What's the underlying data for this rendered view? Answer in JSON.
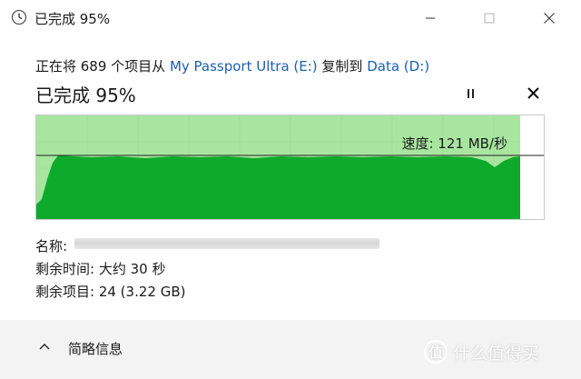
{
  "window": {
    "title": "已完成 95%",
    "icon": "clock-icon"
  },
  "transfer": {
    "desc_prefix": "正在将 689 个项目从",
    "source": "My Passport Ultra (E:)",
    "desc_middle": "复制到",
    "destination": "Data (D:)",
    "status": "已完成 95%",
    "progress_fraction": 0.95,
    "speed": "速度: 121 MB/秒"
  },
  "details": {
    "name_label": "名称:",
    "time_remaining": "剩余时间: 大约 30 秒",
    "items_remaining": "剩余项目: 24 (3.22 GB)"
  },
  "footer": {
    "less_details": "简略信息",
    "watermark": "什么值得买"
  },
  "colors": {
    "progress_light": "#a8e6a0",
    "progress_dark": "#0eaa2c",
    "link": "#1b5fb4",
    "footer_bg": "#f3f3f3"
  }
}
